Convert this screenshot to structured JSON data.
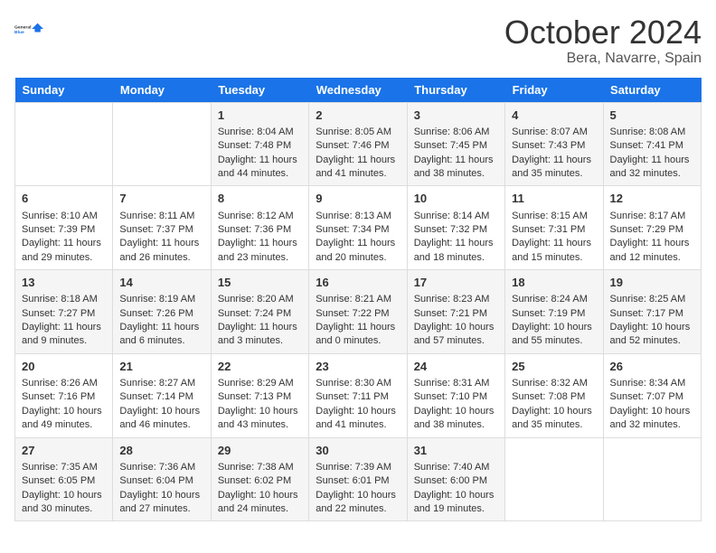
{
  "header": {
    "logo_general": "General",
    "logo_blue": "Blue",
    "month_title": "October 2024",
    "location": "Bera, Navarre, Spain"
  },
  "days_of_week": [
    "Sunday",
    "Monday",
    "Tuesday",
    "Wednesday",
    "Thursday",
    "Friday",
    "Saturday"
  ],
  "weeks": [
    [
      {
        "day": "",
        "sunrise": "",
        "sunset": "",
        "daylight": ""
      },
      {
        "day": "",
        "sunrise": "",
        "sunset": "",
        "daylight": ""
      },
      {
        "day": "1",
        "sunrise": "Sunrise: 8:04 AM",
        "sunset": "Sunset: 7:48 PM",
        "daylight": "Daylight: 11 hours and 44 minutes."
      },
      {
        "day": "2",
        "sunrise": "Sunrise: 8:05 AM",
        "sunset": "Sunset: 7:46 PM",
        "daylight": "Daylight: 11 hours and 41 minutes."
      },
      {
        "day": "3",
        "sunrise": "Sunrise: 8:06 AM",
        "sunset": "Sunset: 7:45 PM",
        "daylight": "Daylight: 11 hours and 38 minutes."
      },
      {
        "day": "4",
        "sunrise": "Sunrise: 8:07 AM",
        "sunset": "Sunset: 7:43 PM",
        "daylight": "Daylight: 11 hours and 35 minutes."
      },
      {
        "day": "5",
        "sunrise": "Sunrise: 8:08 AM",
        "sunset": "Sunset: 7:41 PM",
        "daylight": "Daylight: 11 hours and 32 minutes."
      }
    ],
    [
      {
        "day": "6",
        "sunrise": "Sunrise: 8:10 AM",
        "sunset": "Sunset: 7:39 PM",
        "daylight": "Daylight: 11 hours and 29 minutes."
      },
      {
        "day": "7",
        "sunrise": "Sunrise: 8:11 AM",
        "sunset": "Sunset: 7:37 PM",
        "daylight": "Daylight: 11 hours and 26 minutes."
      },
      {
        "day": "8",
        "sunrise": "Sunrise: 8:12 AM",
        "sunset": "Sunset: 7:36 PM",
        "daylight": "Daylight: 11 hours and 23 minutes."
      },
      {
        "day": "9",
        "sunrise": "Sunrise: 8:13 AM",
        "sunset": "Sunset: 7:34 PM",
        "daylight": "Daylight: 11 hours and 20 minutes."
      },
      {
        "day": "10",
        "sunrise": "Sunrise: 8:14 AM",
        "sunset": "Sunset: 7:32 PM",
        "daylight": "Daylight: 11 hours and 18 minutes."
      },
      {
        "day": "11",
        "sunrise": "Sunrise: 8:15 AM",
        "sunset": "Sunset: 7:31 PM",
        "daylight": "Daylight: 11 hours and 15 minutes."
      },
      {
        "day": "12",
        "sunrise": "Sunrise: 8:17 AM",
        "sunset": "Sunset: 7:29 PM",
        "daylight": "Daylight: 11 hours and 12 minutes."
      }
    ],
    [
      {
        "day": "13",
        "sunrise": "Sunrise: 8:18 AM",
        "sunset": "Sunset: 7:27 PM",
        "daylight": "Daylight: 11 hours and 9 minutes."
      },
      {
        "day": "14",
        "sunrise": "Sunrise: 8:19 AM",
        "sunset": "Sunset: 7:26 PM",
        "daylight": "Daylight: 11 hours and 6 minutes."
      },
      {
        "day": "15",
        "sunrise": "Sunrise: 8:20 AM",
        "sunset": "Sunset: 7:24 PM",
        "daylight": "Daylight: 11 hours and 3 minutes."
      },
      {
        "day": "16",
        "sunrise": "Sunrise: 8:21 AM",
        "sunset": "Sunset: 7:22 PM",
        "daylight": "Daylight: 11 hours and 0 minutes."
      },
      {
        "day": "17",
        "sunrise": "Sunrise: 8:23 AM",
        "sunset": "Sunset: 7:21 PM",
        "daylight": "Daylight: 10 hours and 57 minutes."
      },
      {
        "day": "18",
        "sunrise": "Sunrise: 8:24 AM",
        "sunset": "Sunset: 7:19 PM",
        "daylight": "Daylight: 10 hours and 55 minutes."
      },
      {
        "day": "19",
        "sunrise": "Sunrise: 8:25 AM",
        "sunset": "Sunset: 7:17 PM",
        "daylight": "Daylight: 10 hours and 52 minutes."
      }
    ],
    [
      {
        "day": "20",
        "sunrise": "Sunrise: 8:26 AM",
        "sunset": "Sunset: 7:16 PM",
        "daylight": "Daylight: 10 hours and 49 minutes."
      },
      {
        "day": "21",
        "sunrise": "Sunrise: 8:27 AM",
        "sunset": "Sunset: 7:14 PM",
        "daylight": "Daylight: 10 hours and 46 minutes."
      },
      {
        "day": "22",
        "sunrise": "Sunrise: 8:29 AM",
        "sunset": "Sunset: 7:13 PM",
        "daylight": "Daylight: 10 hours and 43 minutes."
      },
      {
        "day": "23",
        "sunrise": "Sunrise: 8:30 AM",
        "sunset": "Sunset: 7:11 PM",
        "daylight": "Daylight: 10 hours and 41 minutes."
      },
      {
        "day": "24",
        "sunrise": "Sunrise: 8:31 AM",
        "sunset": "Sunset: 7:10 PM",
        "daylight": "Daylight: 10 hours and 38 minutes."
      },
      {
        "day": "25",
        "sunrise": "Sunrise: 8:32 AM",
        "sunset": "Sunset: 7:08 PM",
        "daylight": "Daylight: 10 hours and 35 minutes."
      },
      {
        "day": "26",
        "sunrise": "Sunrise: 8:34 AM",
        "sunset": "Sunset: 7:07 PM",
        "daylight": "Daylight: 10 hours and 32 minutes."
      }
    ],
    [
      {
        "day": "27",
        "sunrise": "Sunrise: 7:35 AM",
        "sunset": "Sunset: 6:05 PM",
        "daylight": "Daylight: 10 hours and 30 minutes."
      },
      {
        "day": "28",
        "sunrise": "Sunrise: 7:36 AM",
        "sunset": "Sunset: 6:04 PM",
        "daylight": "Daylight: 10 hours and 27 minutes."
      },
      {
        "day": "29",
        "sunrise": "Sunrise: 7:38 AM",
        "sunset": "Sunset: 6:02 PM",
        "daylight": "Daylight: 10 hours and 24 minutes."
      },
      {
        "day": "30",
        "sunrise": "Sunrise: 7:39 AM",
        "sunset": "Sunset: 6:01 PM",
        "daylight": "Daylight: 10 hours and 22 minutes."
      },
      {
        "day": "31",
        "sunrise": "Sunrise: 7:40 AM",
        "sunset": "Sunset: 6:00 PM",
        "daylight": "Daylight: 10 hours and 19 minutes."
      },
      {
        "day": "",
        "sunrise": "",
        "sunset": "",
        "daylight": ""
      },
      {
        "day": "",
        "sunrise": "",
        "sunset": "",
        "daylight": ""
      }
    ]
  ]
}
